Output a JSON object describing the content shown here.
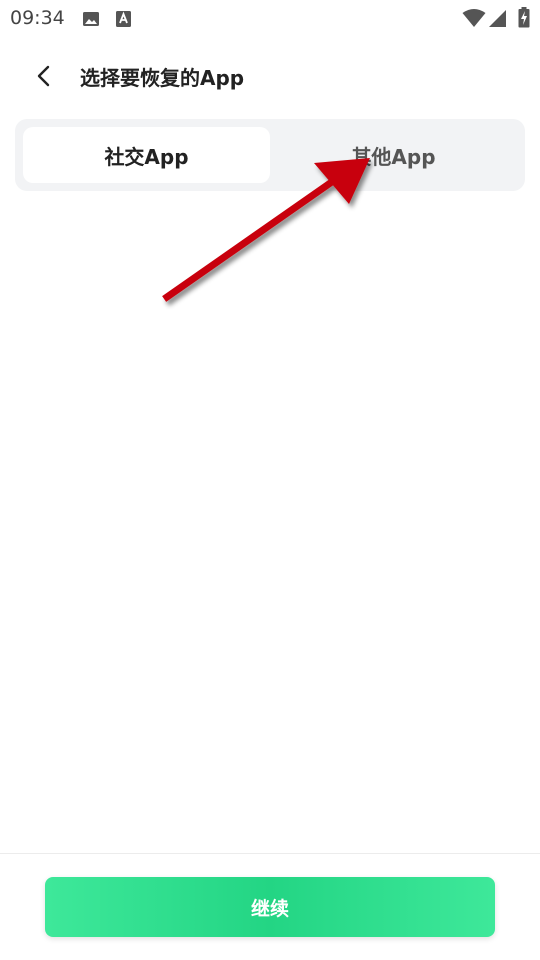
{
  "status_bar": {
    "time": "09:34",
    "icons": [
      "image-icon",
      "text-a-icon",
      "wifi-icon",
      "signal-icon",
      "battery-charging-icon"
    ]
  },
  "header": {
    "title": "选择要恢复的App",
    "back_icon": "back-chevron-icon"
  },
  "tabs": [
    {
      "label": "社交App",
      "active": true
    },
    {
      "label": "其他App",
      "active": false
    }
  ],
  "annotation": {
    "type": "red-arrow",
    "color": "#c8000a"
  },
  "footer": {
    "continue_label": "继续",
    "button_color": "#2ad88c"
  }
}
